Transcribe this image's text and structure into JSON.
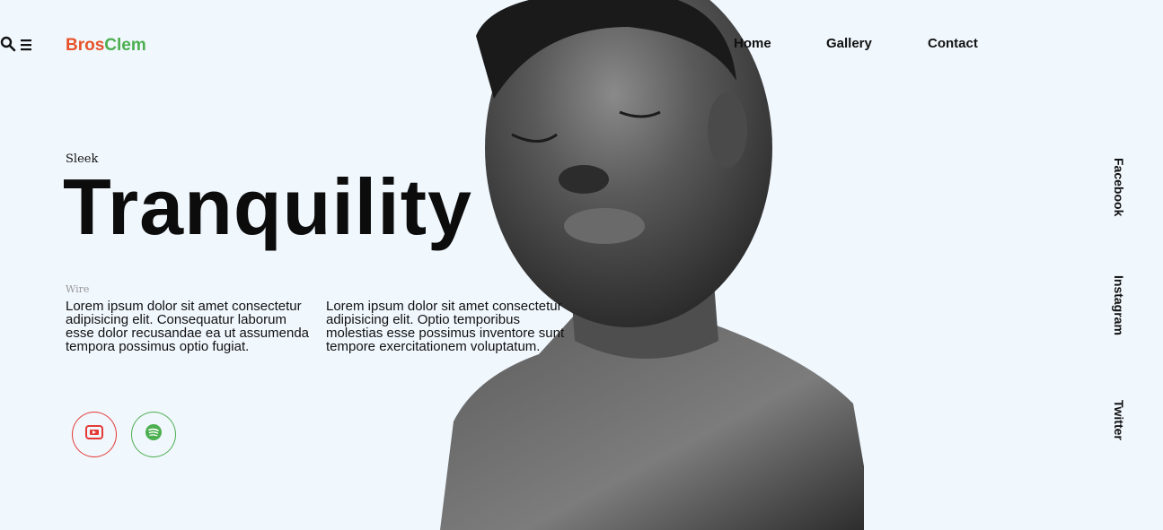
{
  "brand": {
    "part1": "Bros",
    "part2": "Clem"
  },
  "nav": {
    "home": "Home",
    "gallery": "Gallery",
    "contact": "Contact",
    "search_icon": "search-icon",
    "menu_icon": "hamburger-menu-icon"
  },
  "hero": {
    "eyebrow": "Sleek",
    "headline": "Tranquility",
    "subtag": "Wire",
    "paragraph_1": "Lorem ipsum dolor sit amet consectetur adipisicing elit. Consequatur laborum esse dolor recusandae ea ut assumenda tempora possimus optio fugiat.",
    "paragraph_2": "Lorem ipsum dolor sit amet consectetur adipisicing elit. Optio temporibus molestias esse possimus inventore sunt tempore exercitationem voluptatum."
  },
  "media_buttons": {
    "youtube_icon": "youtube-icon",
    "spotify_icon": "spotify-icon"
  },
  "social": {
    "facebook": "Facebook",
    "instagram": "Instagram",
    "twitter": "Twitter"
  },
  "colors": {
    "accent_orange": "#e8522a",
    "accent_green": "#4caf50",
    "youtube_red": "#e53935",
    "background": "#f0f7fd"
  }
}
